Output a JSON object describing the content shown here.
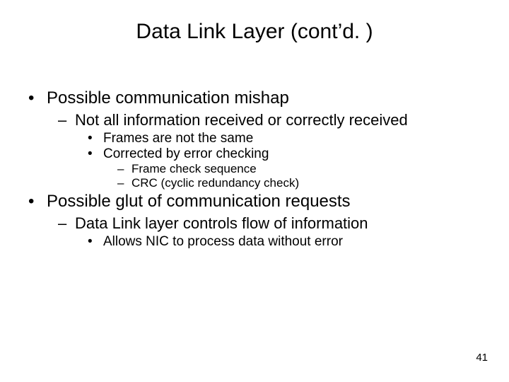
{
  "title": "Data Link Layer (cont’d. )",
  "bullets": [
    {
      "text": "Possible communication mishap",
      "children": [
        {
          "text": "Not all information received or correctly received",
          "children": [
            {
              "text": "Frames are not the same",
              "children": []
            },
            {
              "text": "Corrected by error checking",
              "children": [
                {
                  "text": "Frame check sequence"
                },
                {
                  "text": "CRC (cyclic redundancy check)"
                }
              ]
            }
          ]
        }
      ]
    },
    {
      "text": "Possible glut of communication requests",
      "children": [
        {
          "text": "Data Link layer controls flow of information",
          "children": [
            {
              "text": "Allows NIC to process data without error",
              "children": []
            }
          ]
        }
      ]
    }
  ],
  "glyphs": {
    "dot": "•",
    "dash": "–"
  },
  "page_number": "41"
}
